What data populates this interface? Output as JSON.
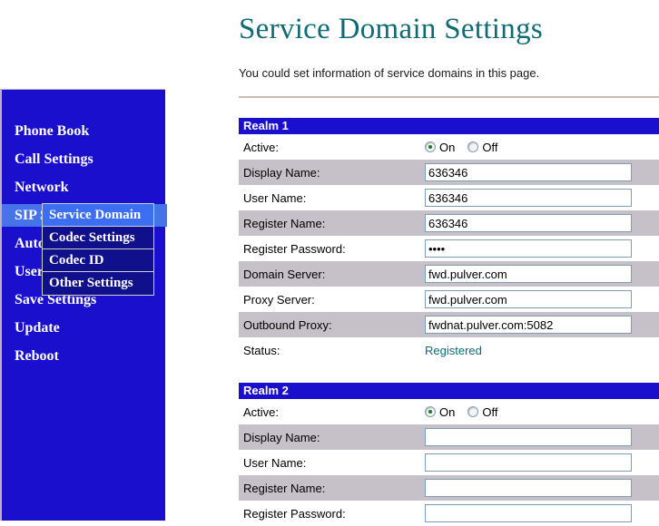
{
  "page": {
    "title": "Service Domain Settings",
    "subtitle": "You could set information of service domains in this page."
  },
  "sidebar": {
    "items": [
      {
        "label": "Phone Book",
        "selected": false
      },
      {
        "label": "Call Settings",
        "selected": false
      },
      {
        "label": "Network",
        "selected": false
      },
      {
        "label": "SIP Settings",
        "selected": true
      },
      {
        "label": "Auto Provision",
        "selected": false
      },
      {
        "label": "User Settings",
        "selected": false
      },
      {
        "label": "Save Settings",
        "selected": false
      },
      {
        "label": "Update",
        "selected": false
      },
      {
        "label": "Reboot",
        "selected": false
      }
    ]
  },
  "submenu": {
    "items": [
      {
        "label": "Service Domain",
        "active": true
      },
      {
        "label": "Codec Settings",
        "active": false
      },
      {
        "label": "Codec ID",
        "active": false
      },
      {
        "label": "Other Settings",
        "active": false
      }
    ]
  },
  "radio": {
    "on_label": "On",
    "off_label": "Off"
  },
  "realms": [
    {
      "header": "Realm 1",
      "active": "on",
      "active_label": "Active:",
      "fields": [
        {
          "label": "Display Name:",
          "value": "636346",
          "type": "text"
        },
        {
          "label": "User Name:",
          "value": "636346",
          "type": "text"
        },
        {
          "label": "Register Name:",
          "value": "636346",
          "type": "text"
        },
        {
          "label": "Register Password:",
          "value": "1234",
          "type": "password"
        },
        {
          "label": "Domain Server:",
          "value": "fwd.pulver.com",
          "type": "text"
        },
        {
          "label": "Proxy Server:",
          "value": "fwd.pulver.com",
          "type": "text"
        },
        {
          "label": "Outbound Proxy:",
          "value": "fwdnat.pulver.com:5082",
          "type": "text"
        }
      ],
      "status_label": "Status:",
      "status_value": "Registered"
    },
    {
      "header": "Realm 2",
      "active": "on",
      "active_label": "Active:",
      "fields": [
        {
          "label": "Display Name:",
          "value": "",
          "type": "text"
        },
        {
          "label": "User Name:",
          "value": "",
          "type": "text"
        },
        {
          "label": "Register Name:",
          "value": "",
          "type": "text"
        },
        {
          "label": "Register Password:",
          "value": "",
          "type": "password"
        }
      ]
    }
  ]
}
